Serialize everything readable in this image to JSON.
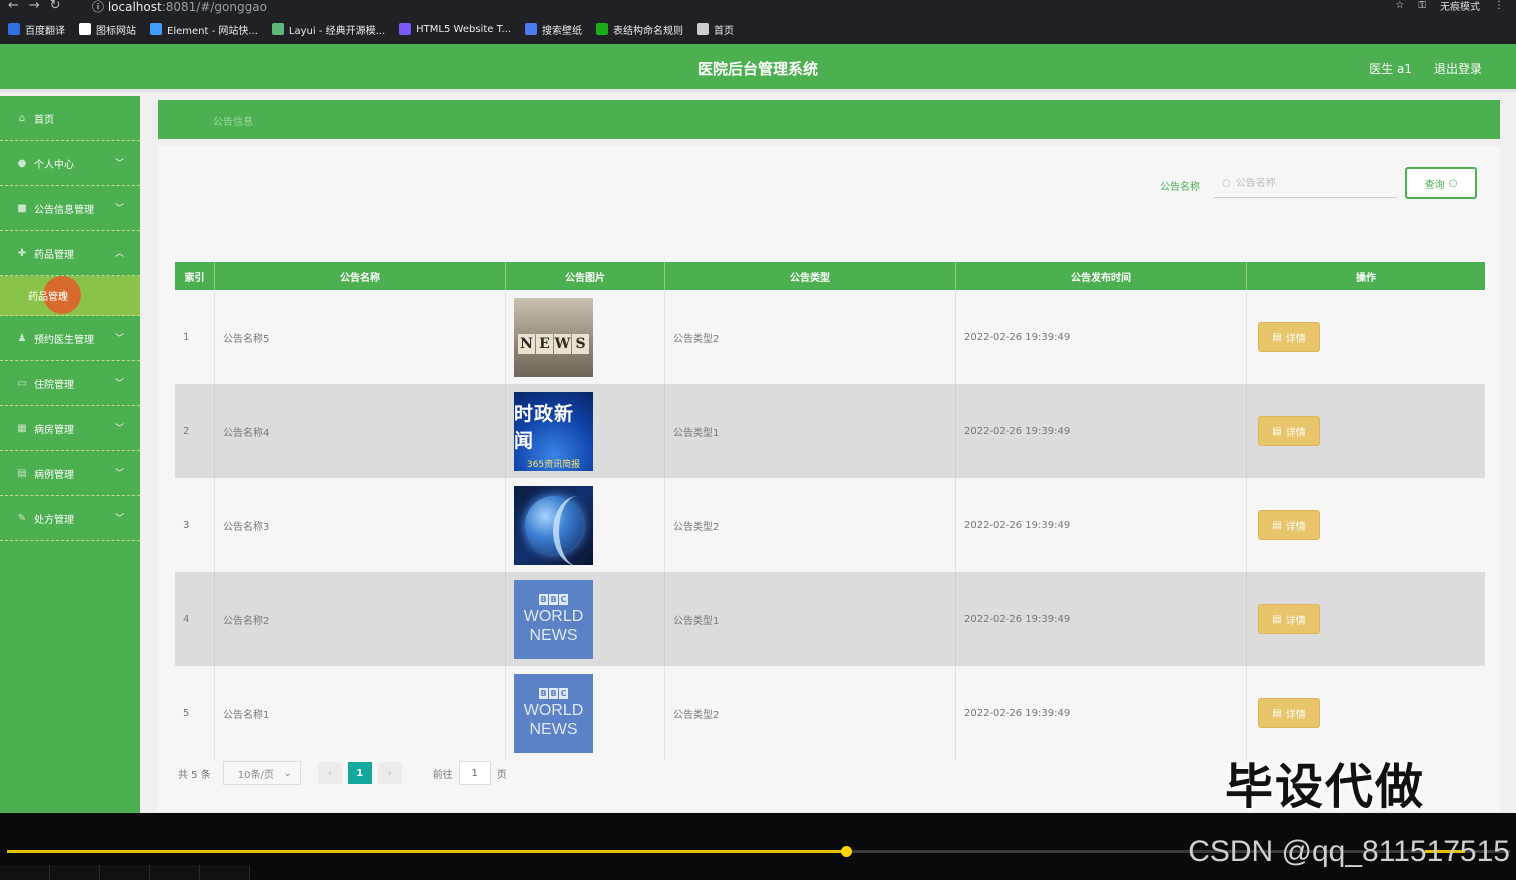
{
  "browser": {
    "url_host": "localhost",
    "url_rest": ":8081/#/gonggao",
    "incognito_label": "无痕模式",
    "bookmarks": [
      {
        "label": "百度翻译",
        "color": "#2f6fe0"
      },
      {
        "label": "图标网站",
        "color": "#ffffff"
      },
      {
        "label": "Element - 网站快...",
        "color": "#409eff"
      },
      {
        "label": "Layui - 经典开源模...",
        "color": "#5fb878"
      },
      {
        "label": "HTML5 Website T...",
        "color": "#7a5af8"
      },
      {
        "label": "搜索壁纸",
        "color": "#4a7cf0"
      },
      {
        "label": "表结构命名规则",
        "color": "#1aad19"
      },
      {
        "label": "首页",
        "color": "#cccccc"
      }
    ]
  },
  "header": {
    "title": "医院后台管理系统",
    "user": "医生 a1",
    "logout": "退出登录"
  },
  "sidebar": {
    "items": [
      {
        "label": "首页",
        "icon": "home-icon",
        "has_children": false
      },
      {
        "label": "个人中心",
        "icon": "user-icon",
        "has_children": true
      },
      {
        "label": "公告信息管理",
        "icon": "notice-icon",
        "has_children": true
      },
      {
        "label": "药品管理",
        "icon": "medicine-icon",
        "has_children": true,
        "expanded": true
      }
    ],
    "sub_item": "药品管理",
    "items_after": [
      {
        "label": "预约医生管理",
        "icon": "doctor-icon"
      },
      {
        "label": "住院管理",
        "icon": "bed-icon"
      },
      {
        "label": "病房管理",
        "icon": "ward-icon"
      },
      {
        "label": "病例管理",
        "icon": "case-icon"
      },
      {
        "label": "处方管理",
        "icon": "prescription-icon"
      }
    ]
  },
  "breadcrumb": "公告信息",
  "search": {
    "label": "公告名称",
    "placeholder": "公告名称",
    "button": "查询"
  },
  "table": {
    "headers": [
      "索引",
      "公告名称",
      "公告图片",
      "公告类型",
      "公告发布时间",
      "操作"
    ],
    "rows": [
      {
        "index": "1",
        "name": "公告名称5",
        "image": "news",
        "type": "公告类型2",
        "time": "2022-02-26 19:39:49"
      },
      {
        "index": "2",
        "name": "公告名称4",
        "image": "cn",
        "type": "公告类型1",
        "time": "2022-02-26 19:39:49"
      },
      {
        "index": "3",
        "name": "公告名称3",
        "image": "globe",
        "type": "公告类型2",
        "time": "2022-02-26 19:39:49"
      },
      {
        "index": "4",
        "name": "公告名称2",
        "image": "bbc",
        "type": "公告类型1",
        "time": "2022-02-26 19:39:49"
      },
      {
        "index": "5",
        "name": "公告名称1",
        "image": "bbc",
        "type": "公告类型2",
        "time": "2022-02-26 19:39:49"
      }
    ],
    "detail_label": "详情"
  },
  "thumb_text": {
    "news": [
      "N",
      "E",
      "W",
      "S"
    ],
    "cn_big": "时政新闻",
    "cn_small": "365资讯简报",
    "bbc": "BBC",
    "world": "WORLD",
    "news_word": "NEWS"
  },
  "pager": {
    "total": "共 5 条",
    "size": "10条/页",
    "current": "1",
    "goto_prefix": "前往",
    "goto_value": "1",
    "goto_suffix": "页"
  },
  "overlay": {
    "watermark": "毕设代做",
    "csdn": "CSDN @qq_811517515"
  },
  "player": {
    "progress": 0.56
  },
  "colors": {
    "primary": "#4caf50",
    "detail": "#e8c56a",
    "page_active": "#13a89e"
  }
}
